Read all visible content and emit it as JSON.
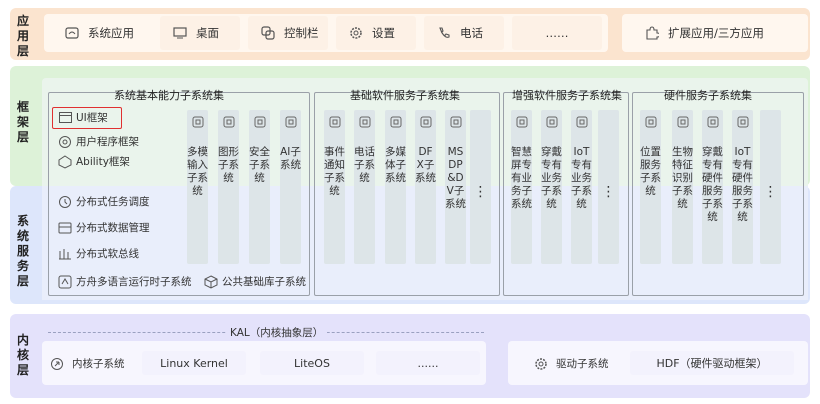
{
  "layers": {
    "app": "应用层",
    "frame": "框架层",
    "sys": "系统服务层",
    "kernel": "内核层"
  },
  "app": {
    "items": [
      "系统应用",
      "桌面",
      "控制栏",
      "设置",
      "电话",
      "……"
    ],
    "extra": "扩展应用/三方应用"
  },
  "groups": [
    {
      "title": "系统基本能力子系统集"
    },
    {
      "title": "基础软件服务子系统集"
    },
    {
      "title": "增强软件服务子系统集"
    },
    {
      "title": "硬件服务子系统集"
    }
  ],
  "frame_items": [
    "UI框架",
    "用户程序框架",
    "Ability框架"
  ],
  "sys_items": [
    "分布式任务调度",
    "分布式数据管理",
    "分布式软总线",
    "方舟多语言运行时子系统",
    "公共基础库子系统"
  ],
  "columns": [
    "多模输入子系统",
    "图形子系统",
    "安全子系统",
    "AI子系统",
    "事件通知子系统",
    "电话子系统",
    "多媒体子系统",
    "DFX子系统",
    "MSDP&DV子系统",
    "⋮",
    "智慧屏专有业务子系统",
    "穿戴专有业务子系统",
    "IoT专有业务子系统",
    "⋮",
    "位置服务子系统",
    "生物特征识别子系统",
    "穿戴专有硬件服务子系统",
    "IoT专有硬件服务子系统",
    "⋮"
  ],
  "kernel": {
    "kal": "KAL（内核抽象层）",
    "sub_label": "内核子系统",
    "items": [
      "Linux Kernel",
      "LiteOS",
      "......"
    ],
    "driver_label": "驱动子系统",
    "hdf": "HDF（硬件驱动框架）"
  },
  "colors": {
    "highlight": "#e03030"
  }
}
